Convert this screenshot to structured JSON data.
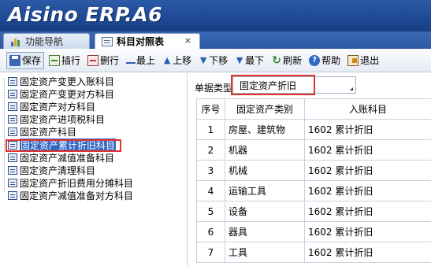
{
  "app": {
    "title": "Aisino ERP.A6"
  },
  "tabs": [
    {
      "label": "功能导航"
    },
    {
      "label": "科目对照表",
      "close": "×"
    }
  ],
  "toolbar": {
    "save": "保存",
    "insert": "插行",
    "delete": "删行",
    "top": "最上",
    "up": "上移",
    "down": "下移",
    "bottom": "最下",
    "refresh": "刷新",
    "help": "帮助",
    "exit": "退出"
  },
  "tree": {
    "items": [
      {
        "label": "固定资产变更入账科目"
      },
      {
        "label": "固定资产变更对方科目"
      },
      {
        "label": "固定资产对方科目"
      },
      {
        "label": "固定资产进项税科目"
      },
      {
        "label": "固定资产科目"
      },
      {
        "label": "固定资产累计折旧科目",
        "selected": true
      },
      {
        "label": "固定资产减值准备科目"
      },
      {
        "label": "固定资产清理科目"
      },
      {
        "label": "固定资产折旧费用分摊科目"
      },
      {
        "label": "固定资产减值准备对方科目"
      }
    ]
  },
  "form": {
    "doc_type_label": "单据类型",
    "doc_type_value": "固定资产折旧"
  },
  "grid": {
    "headers": [
      "序号",
      "固定资产类别",
      "入账科目"
    ],
    "rows": [
      {
        "idx": "1",
        "category": "房屋、建筑物",
        "account": "1602 累计折旧"
      },
      {
        "idx": "2",
        "category": "机器",
        "account": "1602 累计折旧"
      },
      {
        "idx": "3",
        "category": "机械",
        "account": "1602 累计折旧"
      },
      {
        "idx": "4",
        "category": "运输工具",
        "account": "1602 累计折旧"
      },
      {
        "idx": "5",
        "category": "设备",
        "account": "1602 累计折旧"
      },
      {
        "idx": "6",
        "category": "器具",
        "account": "1602 累计折旧"
      },
      {
        "idx": "7",
        "category": "工具",
        "account": "1602 累计折旧"
      }
    ]
  },
  "colors": {
    "brand_blue": "#1f4a95",
    "selection_blue": "#3166c2",
    "highlight_red": "#e0322e"
  }
}
